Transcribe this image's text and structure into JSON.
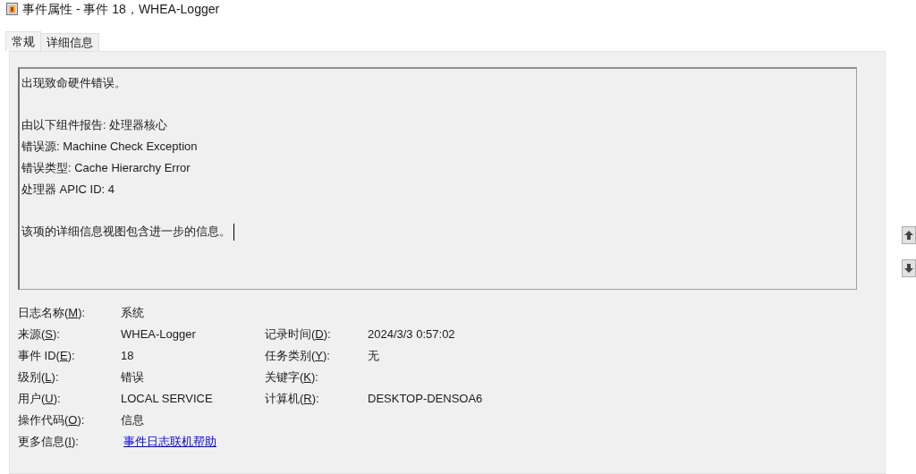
{
  "window": {
    "title": "事件属性 - 事件 18，WHEA-Logger"
  },
  "tabs": [
    {
      "label": "常规",
      "selected": true
    },
    {
      "label": "详细信息",
      "selected": false
    }
  ],
  "description": {
    "paragraphs": [
      [
        "出现致命硬件错误。"
      ],
      [
        "由以下组件报告: 处理器核心",
        "错误源: Machine Check Exception",
        "错误类型: Cache Hierarchy Error",
        "处理器 APIC ID: 4"
      ],
      [
        "该项的详细信息视图包含进一步的信息。"
      ]
    ],
    "caret": true
  },
  "fields": [
    {
      "left": {
        "label": [
          "日志名称(",
          "M",
          "):"
        ],
        "value": "系统",
        "kind": "text"
      }
    },
    {
      "left": {
        "label": [
          "来源(",
          "S",
          "):"
        ],
        "value": "WHEA-Logger",
        "kind": "text"
      },
      "right": {
        "label": [
          "记录时间(",
          "D",
          "):"
        ],
        "value": "2024/3/3 0:57:02",
        "kind": "text"
      }
    },
    {
      "left": {
        "label": [
          "事件 ID(",
          "E",
          "):"
        ],
        "value": "18",
        "kind": "text"
      },
      "right": {
        "label": [
          "任务类别(",
          "Y",
          "):"
        ],
        "value": "无",
        "kind": "text"
      }
    },
    {
      "left": {
        "label": [
          "级别(",
          "L",
          "):"
        ],
        "value": "错误",
        "kind": "text"
      },
      "right": {
        "label": [
          "关键字(",
          "K",
          "):"
        ],
        "kind": "text"
      }
    },
    {
      "left": {
        "label": [
          "用户(",
          "U",
          "):"
        ],
        "value": "LOCAL SERVICE",
        "kind": "text"
      },
      "right": {
        "label": [
          "计算机(",
          "R",
          "):"
        ],
        "value": "DESKTOP-DENSOA6",
        "kind": "text"
      }
    },
    {
      "left": {
        "label": [
          "操作代码(",
          "O",
          "):"
        ],
        "value": "信息",
        "kind": "text"
      }
    },
    {
      "left": {
        "label": [
          "更多信息(",
          "I",
          "):"
        ],
        "value": "事件日志联机帮助",
        "kind": "link"
      }
    }
  ]
}
